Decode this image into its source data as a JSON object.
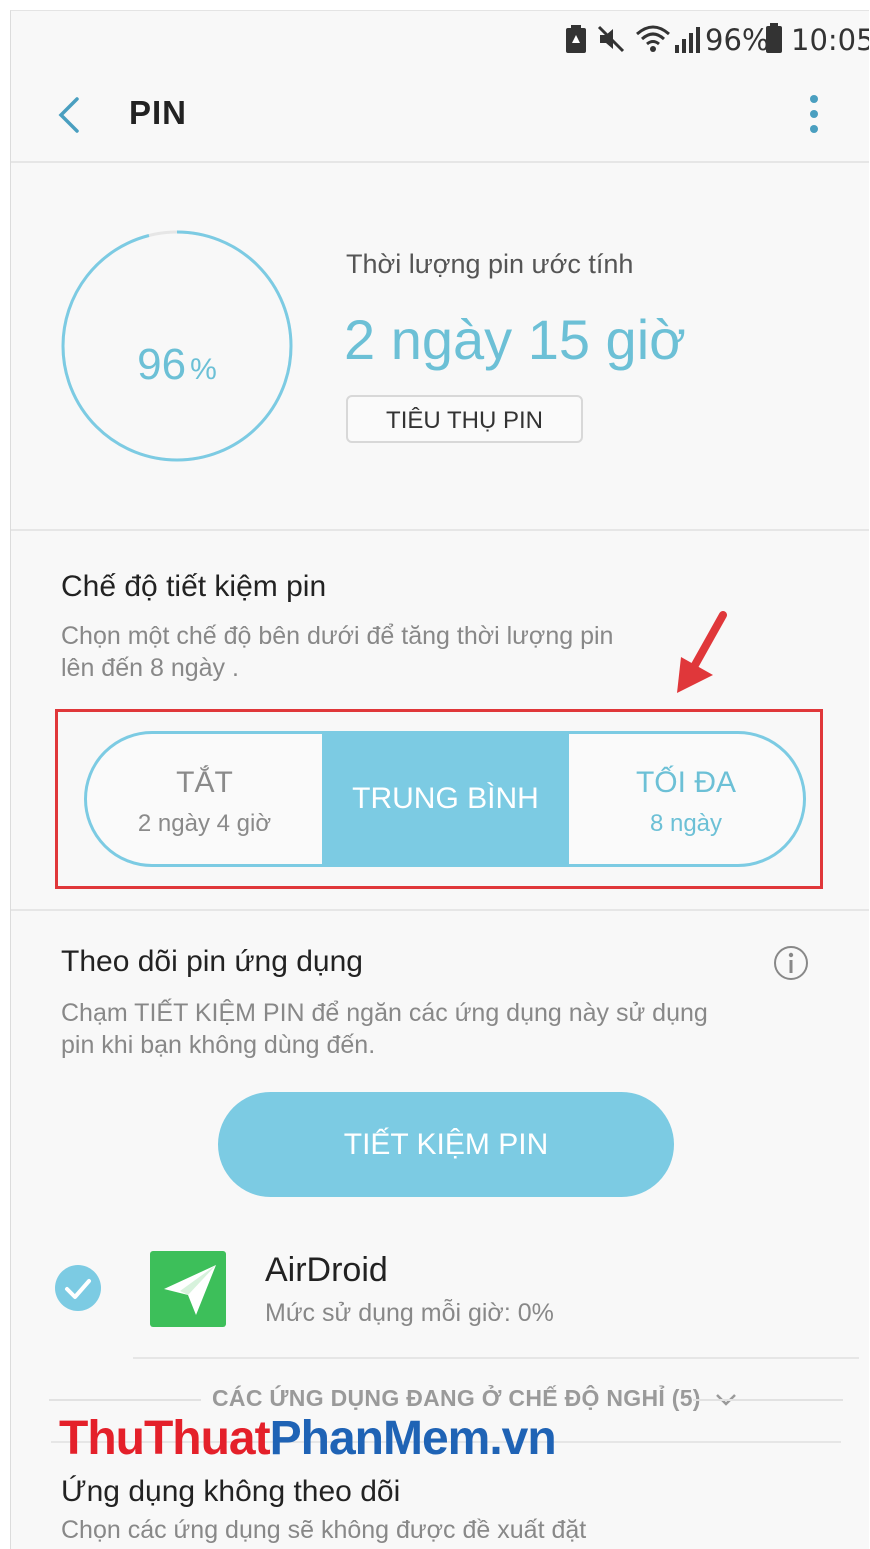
{
  "status_bar": {
    "battery_percent": "96%",
    "time": "10:05",
    "icons": [
      "battery-saver-icon",
      "mute-icon",
      "wifi-icon",
      "signal-icon",
      "battery-icon"
    ]
  },
  "top_bar": {
    "back_icon": "chevron-left-icon",
    "title": "PIN",
    "menu_icon": "more-vert-icon"
  },
  "battery": {
    "level_value": "96",
    "level_unit": "%",
    "level_fraction": 0.96,
    "estimate_label": "Thời lượng pin ước tính",
    "estimate_value": "2 ngày 15 giờ",
    "usage_button": "TIÊU THỤ PIN",
    "accent_color": "#7ccbe3"
  },
  "power_saving": {
    "title": "Chế độ tiết kiệm pin",
    "description_line1": "Chọn một chế độ bên dưới để tăng thời lượng pin",
    "description_line2": "lên đến 8 ngày .",
    "options": [
      {
        "label": "TẮT",
        "sub": "2 ngày 4 giờ"
      },
      {
        "label": "TRUNG BÌNH",
        "sub": ""
      },
      {
        "label": "TỐI ĐA",
        "sub": "8 ngày"
      }
    ],
    "selected_index": 1,
    "highlight_color": "#e0373a"
  },
  "app_monitor": {
    "title": "Theo dõi pin ứng dụng",
    "info_icon": "info-icon",
    "description_line1": "Chạm TIẾT KIỆM PIN để ngăn các ứng dụng này sử dụng",
    "description_line2": "pin khi bạn không dùng đến.",
    "save_button": "TIẾT KIỆM PIN",
    "apps": [
      {
        "name": "AirDroid",
        "usage": "Mức sử dụng mỗi giờ: 0%",
        "checked": true
      }
    ],
    "sleeping_apps_label": "CÁC ỨNG DỤNG ĐANG Ở CHẾ ĐỘ NGHỈ (5)"
  },
  "watermark": {
    "part1": "ThuThuat",
    "part2": "PhanMem.vn"
  },
  "untracked": {
    "title": "Ứng dụng không theo dõi",
    "description": "Chọn các ứng dụng sẽ không được đề xuất đặt"
  }
}
